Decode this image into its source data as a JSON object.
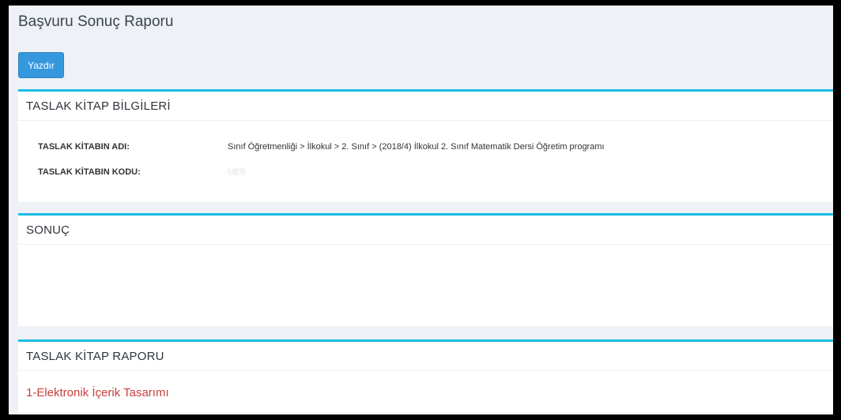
{
  "page": {
    "title": "Başvuru Sonuç Raporu"
  },
  "toolbar": {
    "print_label": "Yazdır"
  },
  "book_info": {
    "title": "TASLAK KİTAP BİLGİLERİ",
    "rows": [
      {
        "label": "TASLAK KİTABIN ADI:",
        "value": "Sınıf Öğretmenliği > İlkokul > 2. Sınıf > (2018/4) İlkokul 2. Sınıf Matematik Dersi Öğretim programı"
      },
      {
        "label": "TASLAK KİTABIN KODU:",
        "value": "UES"
      }
    ]
  },
  "result": {
    "title": "SONUÇ"
  },
  "report": {
    "title": "TASLAK KİTAP RAPORU",
    "sections": [
      {
        "title": "1-Elektronik İçerik Tasarımı"
      }
    ]
  },
  "colors": {
    "accent": "#1bbce6",
    "button": "#3598dc",
    "section_title": "#c9403b",
    "background": "#eef1f5"
  }
}
